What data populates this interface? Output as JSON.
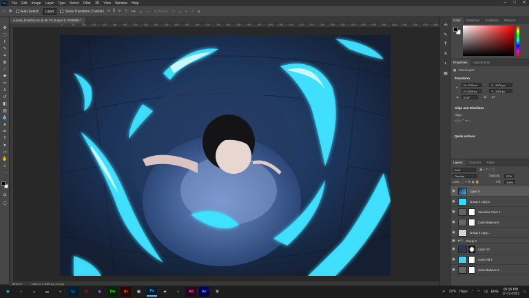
{
  "menubar": {
    "logo": "Ps",
    "items": [
      "File",
      "Edit",
      "Image",
      "Layer",
      "Type",
      "Select",
      "Filter",
      "3D",
      "View",
      "Window",
      "Help"
    ]
  },
  "options": {
    "auto_select_label": "Auto-Select:",
    "auto_select_value": "Layer",
    "transform_label": "Show Transform Controls",
    "mode_3d": "3D Mode:"
  },
  "document": {
    "tab": "sunset_bowl03.psd @ 80.7% (Layer 9, RGB/8#) *",
    "zoom": "80.67%",
    "dims": "1490 px x 1080 px (72 ppi)"
  },
  "ruler_top": [
    "0",
    "50",
    "100",
    "150",
    "200",
    "250",
    "300",
    "350",
    "400",
    "450",
    "500",
    "550",
    "600",
    "650",
    "700",
    "750",
    "800",
    "850",
    "900",
    "950",
    "1000",
    "1050",
    "1100",
    "1150",
    "1200",
    "1250",
    "1300",
    "1350",
    "1400",
    "1450",
    "1500",
    "1550",
    "1600",
    "1650",
    "1700",
    "1750",
    "1800",
    "1850",
    "1900"
  ],
  "color_panel": {
    "tabs": [
      "Color",
      "Swatches",
      "Gradients",
      "Patterns"
    ]
  },
  "properties": {
    "tabs": [
      "Properties",
      "Adjustments"
    ],
    "kind": "Pixel Layer",
    "transform_title": "Transform",
    "w": "W: 4196 px",
    "x": "X: -1576 px",
    "h": "H: 3286 px",
    "y": "Y: -1155 px",
    "angle": "0.00°",
    "align_title": "Align and Distribute",
    "align_label": "Align:",
    "quick_title": "Quick Actions"
  },
  "layers": {
    "tabs": [
      "Layers",
      "Channels",
      "Paths"
    ],
    "kind_label": "Kind",
    "blend_mode": "Overlay",
    "opacity_label": "Opacity:",
    "opacity_value": "37%",
    "lock_label": "Lock:",
    "fill_label": "Fill:",
    "fill_value": "100%",
    "rows": [
      {
        "name": "Layer 9"
      },
      {
        "name": "Group 4 copy 2"
      },
      {
        "name": "Selective Color 1"
      },
      {
        "name": "Color Balance 5"
      },
      {
        "name": "Group 4 copy..."
      },
      {
        "name": "Group 4"
      },
      {
        "name": "Layer 10"
      },
      {
        "name": "Color Fill 1"
      },
      {
        "name": "Color Balance 4"
      }
    ]
  },
  "taskbar": {
    "weather_temp": "72°F",
    "weather_text": "Haze",
    "lang": "ENG",
    "time": "05:26 PM",
    "date": "17-12-2021",
    "apps": [
      "Start",
      "Search",
      "VLC",
      "Folder",
      "WhatsApp",
      "Lr",
      "Opera",
      "Chat",
      "Dw",
      "Ai",
      "Files",
      "Ps",
      "Explorer",
      "Chrome",
      "Xd",
      "Ae",
      "Settings"
    ]
  }
}
